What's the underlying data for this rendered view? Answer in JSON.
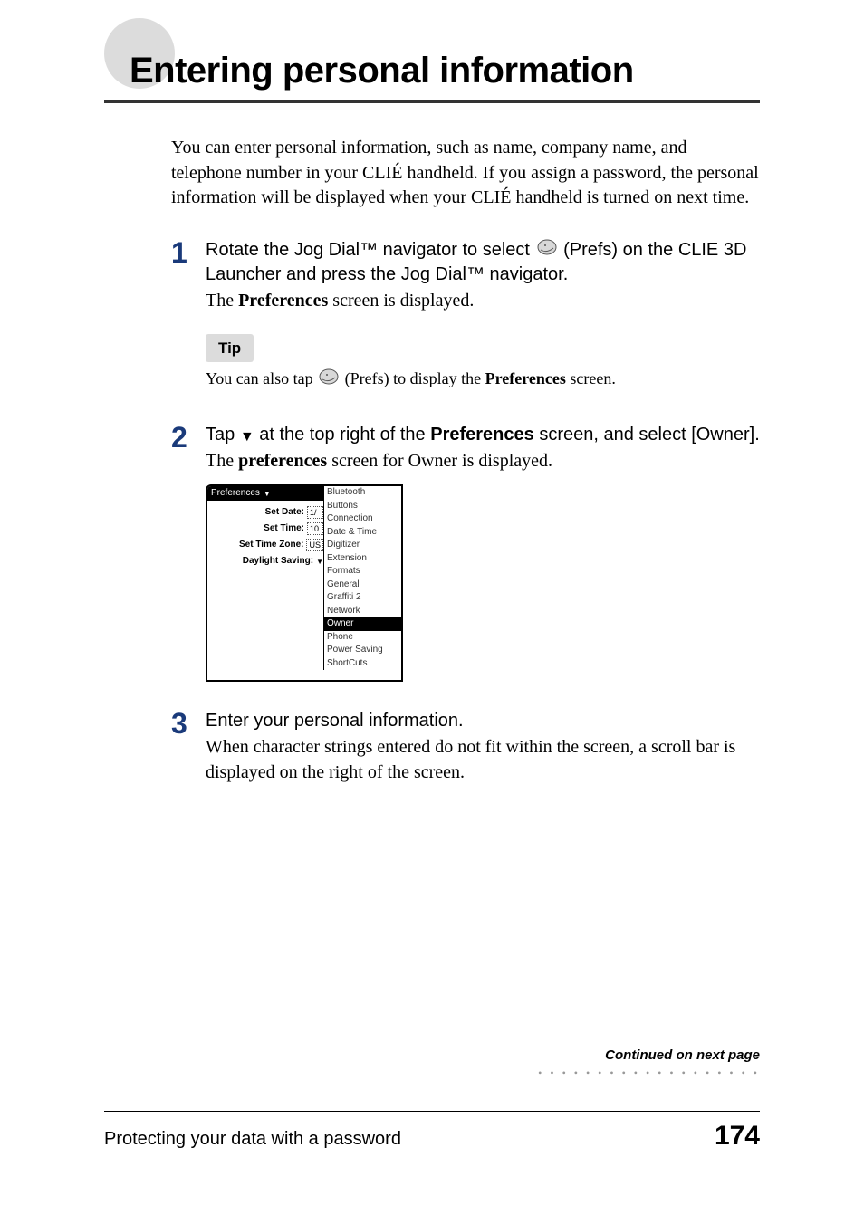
{
  "title": "Entering personal information",
  "intro": "You can enter personal information, such as name, company name, and telephone number in your CLIÉ handheld. If you assign a password, the personal information will be displayed when your CLIÉ handheld is turned on next time.",
  "steps": {
    "s1": {
      "num": "1",
      "instr_a": "Rotate the Jog Dial™ navigator to select ",
      "instr_b": " (Prefs) on the CLIE 3D Launcher and press the Jog Dial™ navigator.",
      "sub_a": "The ",
      "sub_bold": "Preferences",
      "sub_b": " screen is displayed.",
      "tip_label": "Tip",
      "tip_a": "You can also tap ",
      "tip_b": " (Prefs) to display the ",
      "tip_bold": "Preferences",
      "tip_c": " screen."
    },
    "s2": {
      "num": "2",
      "instr_a": "Tap ",
      "instr_b": " at the top right of the ",
      "instr_bold": "Preferences",
      "instr_c": " screen, and select [Owner].",
      "sub_a": "The ",
      "sub_bold": "preferences",
      "sub_b": " screen for Owner is displayed."
    },
    "s3": {
      "num": "3",
      "instr": "Enter your personal information.",
      "sub": "When character strings entered do not fit within the screen, a scroll bar is displayed on the right of the screen."
    }
  },
  "figure": {
    "header": "Preferences",
    "rows": {
      "set_date_lbl": "Set Date:",
      "set_date_val": "1/",
      "set_time_lbl": "Set Time:",
      "set_time_val": "10",
      "set_tz_lbl": "Set Time Zone:",
      "set_tz_val": "US",
      "dst_lbl": "Daylight Saving:"
    },
    "menu": [
      "Bluetooth",
      "Buttons",
      "Connection",
      "Date & Time",
      "Digitizer",
      "Extension",
      "Formats",
      "General",
      "Graffiti 2",
      "Network",
      "Owner",
      "Phone",
      "Power Saving",
      "ShortCuts"
    ],
    "menu_selected": "Owner"
  },
  "continued": "Continued on next page",
  "footer_left": "Protecting your data with a password",
  "footer_page": "174",
  "icons": {
    "prefs": "prefs-icon",
    "down": "▼"
  }
}
